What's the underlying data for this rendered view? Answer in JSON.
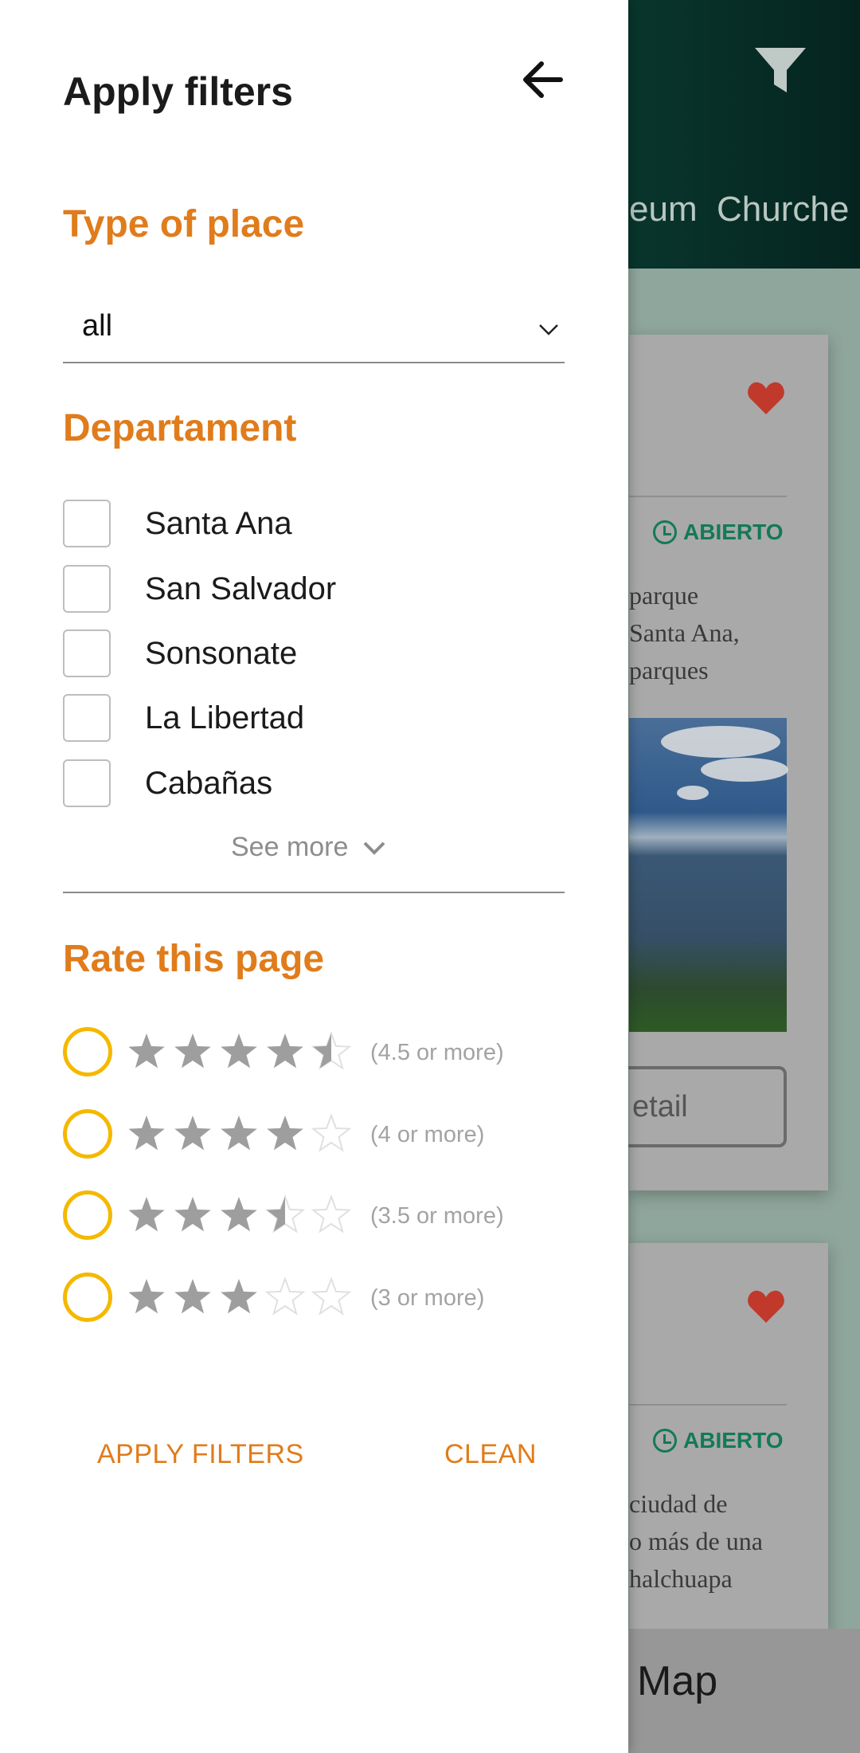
{
  "background": {
    "tabs": [
      "eum",
      "Churche"
    ],
    "card1": {
      "status": "ABIERTO",
      "description": [
        "parque",
        "Santa Ana,",
        "parques"
      ],
      "detail_button": "etail"
    },
    "card2": {
      "status": "ABIERTO",
      "description": [
        "ciudad de",
        "o más de una",
        "halchuapa"
      ]
    },
    "map_label": "Map",
    "colors": {
      "header": "#0c4a3d",
      "heart": "#c0392b",
      "status": "#137a55"
    }
  },
  "drawer": {
    "title": "Apply filters",
    "back_icon": "arrow-left-icon",
    "type_section": {
      "title": "Type of place",
      "selected": "all"
    },
    "department_section": {
      "title": "Departament",
      "items": [
        {
          "label": "Santa Ana",
          "checked": false
        },
        {
          "label": "San Salvador",
          "checked": false
        },
        {
          "label": "Sonsonate",
          "checked": false
        },
        {
          "label": "La Libertad",
          "checked": false
        },
        {
          "label": "Cabañas",
          "checked": false
        }
      ],
      "see_more": "See more"
    },
    "rating_section": {
      "title": "Rate this page",
      "options": [
        {
          "stars": 4.5,
          "label": "(4.5 or more)"
        },
        {
          "stars": 4,
          "label": "(4 or more)"
        },
        {
          "stars": 3.5,
          "label": "(3.5 or more)"
        },
        {
          "stars": 3,
          "label": "(3 or more)"
        }
      ]
    },
    "apply_label": "APPLY FILTERS",
    "clean_label": "CLEAN",
    "colors": {
      "accent": "#e07c1b",
      "radio": "#f5b800",
      "star_filled": "#9e9e9e",
      "star_empty": "#e0e0e0"
    }
  }
}
